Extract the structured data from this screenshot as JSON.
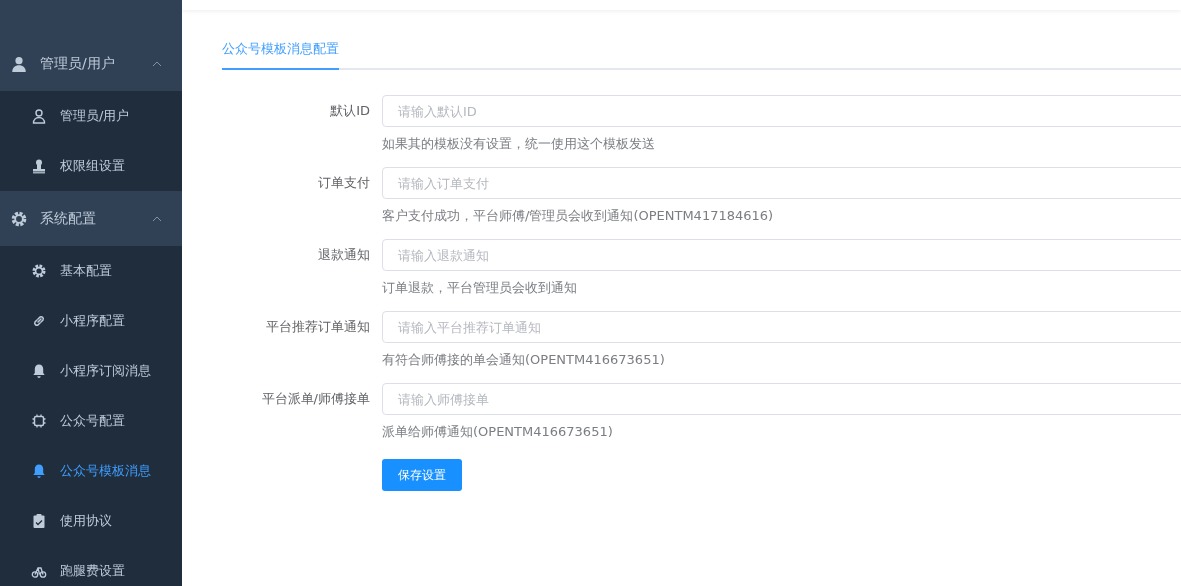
{
  "sidebar": {
    "groups": [
      {
        "label": "管理员/用户",
        "kind": "person",
        "expanded": true,
        "items": [
          {
            "label": "管理员/用户",
            "kind": "user",
            "selected": false
          },
          {
            "label": "权限组设置",
            "kind": "stamp",
            "selected": false
          }
        ]
      },
      {
        "label": "系统配置",
        "kind": "gear",
        "expanded": true,
        "items": [
          {
            "label": "基本配置",
            "kind": "gear",
            "selected": false
          },
          {
            "label": "小程序配置",
            "kind": "link",
            "selected": false
          },
          {
            "label": "小程序订阅消息",
            "kind": "bell",
            "selected": false
          },
          {
            "label": "公众号配置",
            "kind": "chip",
            "selected": false
          },
          {
            "label": "公众号模板消息",
            "kind": "bell",
            "selected": true
          },
          {
            "label": "使用协议",
            "kind": "clipboard",
            "selected": false
          },
          {
            "label": "跑腿费设置",
            "kind": "bike",
            "selected": false
          }
        ]
      }
    ]
  },
  "tabs": [
    {
      "label": "公众号模板消息配置",
      "selected": true
    }
  ],
  "form": {
    "fields": [
      {
        "label": "默认ID",
        "placeholder": "请输入默认ID",
        "hint": "如果其的模板没有设置，统一使用这个模板发送"
      },
      {
        "label": "订单支付",
        "placeholder": "请输入订单支付",
        "hint": "客户支付成功，平台师傅/管理员会收到通知(OPENTM417184616)"
      },
      {
        "label": "退款通知",
        "placeholder": "请输入退款通知",
        "hint": "订单退款，平台管理员会收到通知"
      },
      {
        "label": "平台推荐订单通知",
        "placeholder": "请输入平台推荐订单通知",
        "hint": "有符合师傅接的单会通知(OPENTM416673651)"
      },
      {
        "label": "平台派单/师傅接单",
        "placeholder": "请输入师傅接单",
        "hint": "派单给师傅通知(OPENTM416673651)"
      }
    ],
    "submit": "保存设置"
  }
}
